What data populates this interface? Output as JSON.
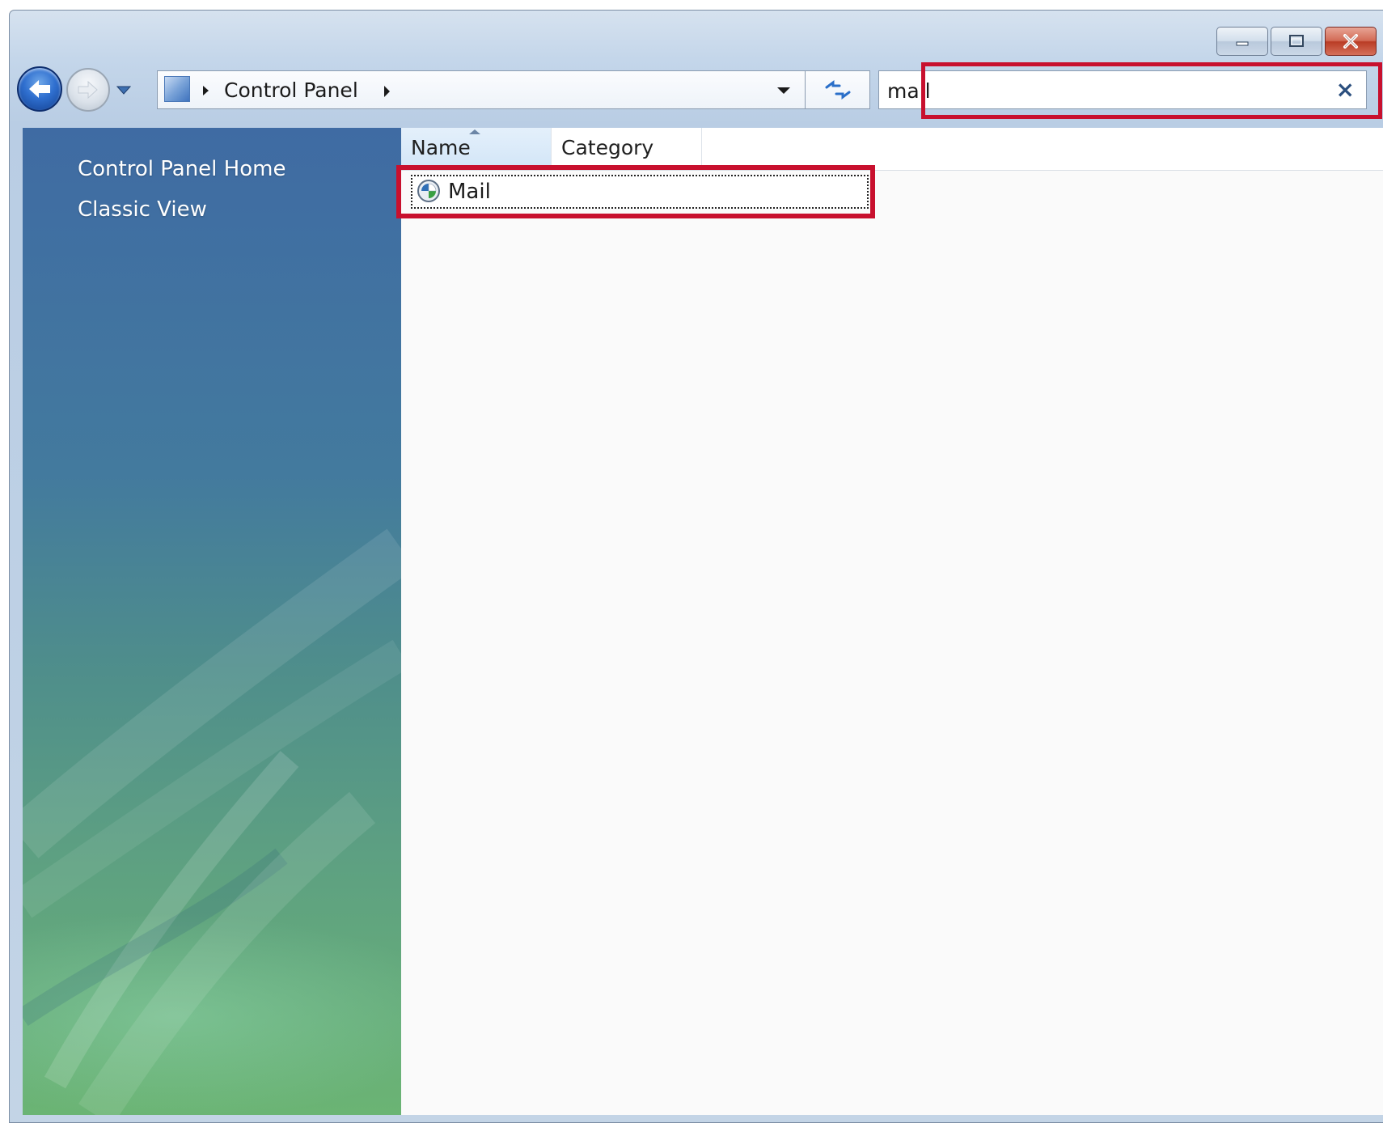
{
  "window": {
    "caption_buttons": [
      "minimize",
      "maximize",
      "close"
    ]
  },
  "navbar": {
    "breadcrumb": "Control Panel",
    "icons": {
      "back": "back-arrow-icon",
      "forward": "forward-arrow-icon",
      "history": "history-dropdown-icon",
      "location": "control-panel-icon",
      "dropdown": "chevron-down-icon",
      "refresh": "refresh-icon"
    }
  },
  "search": {
    "value": "mail",
    "clear_label": "×"
  },
  "sidebar": {
    "links": [
      {
        "label": "Control Panel Home"
      },
      {
        "label": "Classic View"
      }
    ]
  },
  "list": {
    "columns": [
      "Name",
      "Category"
    ],
    "sort_column": "Name",
    "items": [
      {
        "name": "Mail",
        "icon": "mail-icon",
        "selected": true
      }
    ]
  },
  "colors": {
    "highlight": "#c8102e",
    "sidebar_top": "#3f6ba3",
    "sidebar_bottom": "#6bb474"
  }
}
